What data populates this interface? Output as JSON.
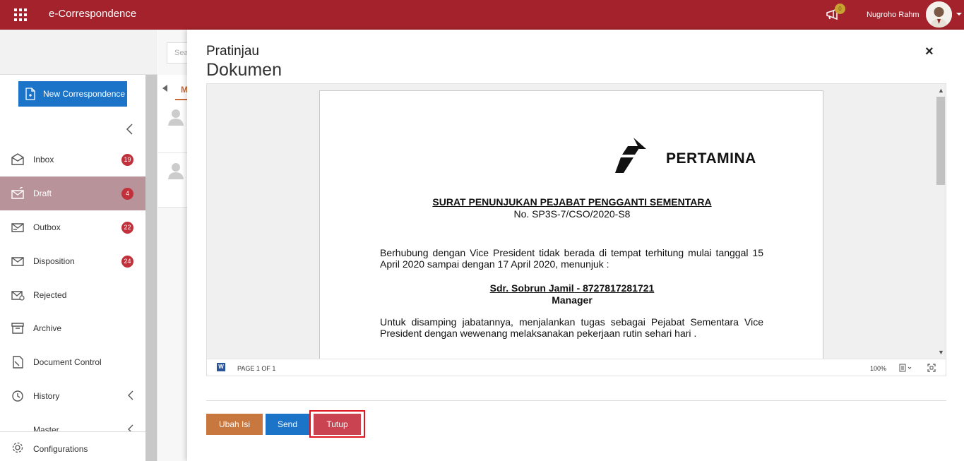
{
  "app": {
    "title": "e-Correspondence",
    "notification_count": "0",
    "username": "Nugroho Rahm"
  },
  "sidebar": {
    "new_button": "New Correspondence",
    "items": [
      {
        "label": "Inbox",
        "badge": "19"
      },
      {
        "label": "Draft",
        "badge": "4",
        "active": true
      },
      {
        "label": "Outbox",
        "badge": "22"
      },
      {
        "label": "Disposition",
        "badge": "24"
      },
      {
        "label": "Rejected",
        "badge": ""
      },
      {
        "label": "Archive",
        "badge": ""
      },
      {
        "label": "Document Control",
        "badge": ""
      },
      {
        "label": "History",
        "badge": ""
      },
      {
        "label": "Master",
        "badge": ""
      }
    ],
    "configurations": "Configurations"
  },
  "middle": {
    "search_placeholder": "Sea",
    "tab": "M"
  },
  "panel": {
    "title_line1": "Pratinjau",
    "title_line2": "Dokumen",
    "close": "×",
    "document": {
      "logo_text": "PERTAMINA",
      "title": "SURAT PENUNJUKAN PEJABAT PENGGANTI SEMENTARA",
      "number": "No. SP3S-7/CSO/2020-S8",
      "paragraph1": "Berhubung dengan Vice President tidak berada di tempat terhitung mulai tanggal 15 April 2020 sampai dengan 17 April 2020, menunjuk :",
      "person_name": "Sdr. Sobrun Jamil - 8727817281721",
      "person_role": "Manager",
      "paragraph2": "Untuk disamping jabatannya, menjalankan tugas sebagai Pejabat Sementara Vice President dengan wewenang melaksanakan pekerjaan rutin sehari hari ."
    },
    "viewer": {
      "page_info": "PAGE 1 OF 1",
      "zoom": "100%"
    },
    "buttons": {
      "edit": "Ubah Isi",
      "send": "Send",
      "close": "Tutup"
    }
  },
  "colors": {
    "brand": "#a3222b",
    "primary": "#1b74c7",
    "edit": "#c8773f",
    "close_btn": "#c94450",
    "badge": "#c0313b"
  }
}
